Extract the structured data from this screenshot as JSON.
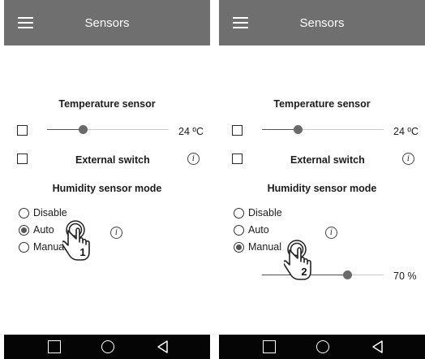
{
  "screens": [
    {
      "appbar": {
        "title": "Sensors",
        "menu_icon": "hamburger-menu-icon"
      },
      "temperature": {
        "title": "Temperature sensor",
        "value": "24 ºC",
        "slider_fraction": 0.29
      },
      "external_switch": {
        "label": "External switch"
      },
      "humidity": {
        "title": "Humidity sensor mode",
        "options": [
          "Disable",
          "Auto",
          "Manual"
        ],
        "selected": "Auto"
      },
      "gesture": {
        "step": "1",
        "icon": "tap-hand-icon"
      }
    },
    {
      "appbar": {
        "title": "Sensors",
        "menu_icon": "hamburger-menu-icon"
      },
      "temperature": {
        "title": "Temperature sensor",
        "value": "24 ºC",
        "slider_fraction": 0.29
      },
      "external_switch": {
        "label": "External switch"
      },
      "humidity": {
        "title": "Humidity sensor mode",
        "options": [
          "Disable",
          "Auto",
          "Manual"
        ],
        "selected": "Manual",
        "manual_value": "70 %",
        "manual_slider_fraction": 0.7
      },
      "gesture": {
        "step": "2",
        "icon": "tap-hand-icon"
      }
    }
  ],
  "navbar": {
    "icons": [
      "recents-square-icon",
      "home-circle-icon",
      "back-triangle-icon"
    ]
  },
  "colors": {
    "appbar": "#6f6f6f",
    "navbar": "#050505",
    "background": "#ffffff"
  }
}
